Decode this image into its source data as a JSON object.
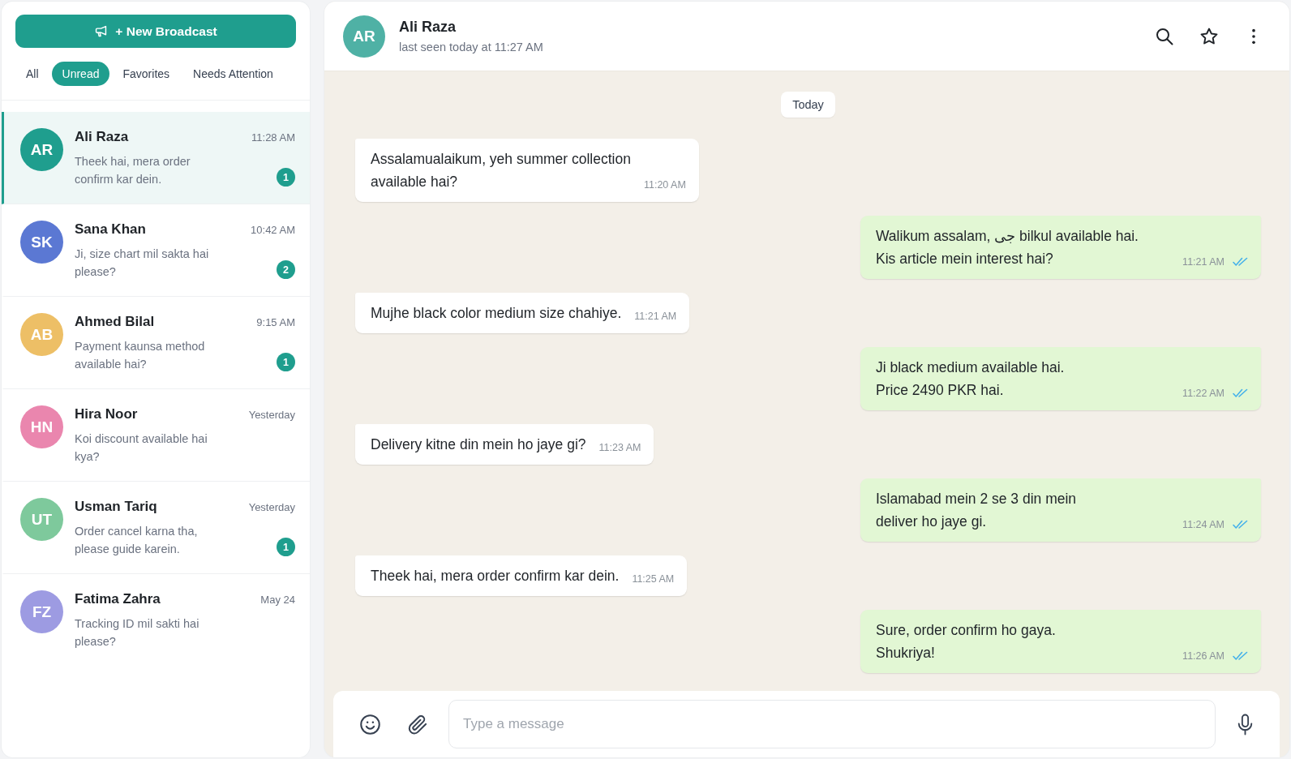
{
  "broadcast_button": {
    "label": "+ New Broadcast"
  },
  "filters": [
    {
      "label": "All",
      "selected": false
    },
    {
      "label": "Unread",
      "selected": true
    },
    {
      "label": "Favorites",
      "selected": false
    },
    {
      "label": "Needs Attention",
      "selected": false
    }
  ],
  "chats": [
    {
      "initials": "AR",
      "color": "#1f9e8e",
      "name": "Ali Raza",
      "time": "11:28 AM",
      "preview": "Theek hai, mera order\nconfirm kar dein.",
      "unread": "1",
      "selected": true
    },
    {
      "initials": "SK",
      "color": "#5b78d3",
      "name": "Sana Khan",
      "time": "10:42 AM",
      "preview": "Ji, size chart mil sakta hai\nplease?",
      "unread": "2",
      "selected": false
    },
    {
      "initials": "AB",
      "color": "#edbf66",
      "name": "Ahmed Bilal",
      "time": "9:15 AM",
      "preview": "Payment kaunsa method\navailable hai?",
      "unread": "1",
      "selected": false
    },
    {
      "initials": "HN",
      "color": "#ea86ae",
      "name": "Hira Noor",
      "time": "Yesterday",
      "preview": "Koi discount available hai\nkya?",
      "selected": false
    },
    {
      "initials": "UT",
      "color": "#7ec99c",
      "name": "Usman Tariq",
      "time": "Yesterday",
      "preview": "Order cancel karna tha,\nplease guide karein.",
      "unread": "1",
      "selected": false
    },
    {
      "initials": "FZ",
      "color": "#9d9be2",
      "name": "Fatima Zahra",
      "time": "May 24",
      "preview": "Tracking ID mil sakti hai\nplease?",
      "selected": false
    }
  ],
  "chat_header": {
    "initials": "AR",
    "name": "Ali Raza",
    "status": "last seen today at 11:27 AM"
  },
  "date_divider": "Today",
  "messages": [
    {
      "kind": "incoming",
      "text": "Assalamualaikum, yeh summer collection\navailable hai?",
      "time": "11:20 AM"
    },
    {
      "kind": "outgoing",
      "text": "Walikum assalam, جی bilkul available hai.\nKis article mein interest hai?",
      "time": "11:21 AM",
      "read": true
    },
    {
      "kind": "incoming",
      "text": "Mujhe black color medium size chahiye.",
      "time": "11:21 AM"
    },
    {
      "kind": "outgoing",
      "text": "Ji black medium available hai.\nPrice 2490 PKR hai.",
      "time": "11:22 AM",
      "read": true
    },
    {
      "kind": "incoming",
      "text": "Delivery kitne din mein ho jaye gi?",
      "time": "11:23 AM"
    },
    {
      "kind": "outgoing",
      "text": "Islamabad mein 2 se 3 din mein\ndeliver ho jaye gi.",
      "time": "11:24 AM",
      "read": true
    },
    {
      "kind": "incoming",
      "text": "Theek hai, mera order confirm kar dein.",
      "time": "11:25 AM"
    },
    {
      "kind": "outgoing",
      "text": "Sure, order confirm ho gaya.\nShukriya!",
      "time": "11:26 AM",
      "read": true
    }
  ],
  "composer": {
    "placeholder": "Type a message"
  }
}
